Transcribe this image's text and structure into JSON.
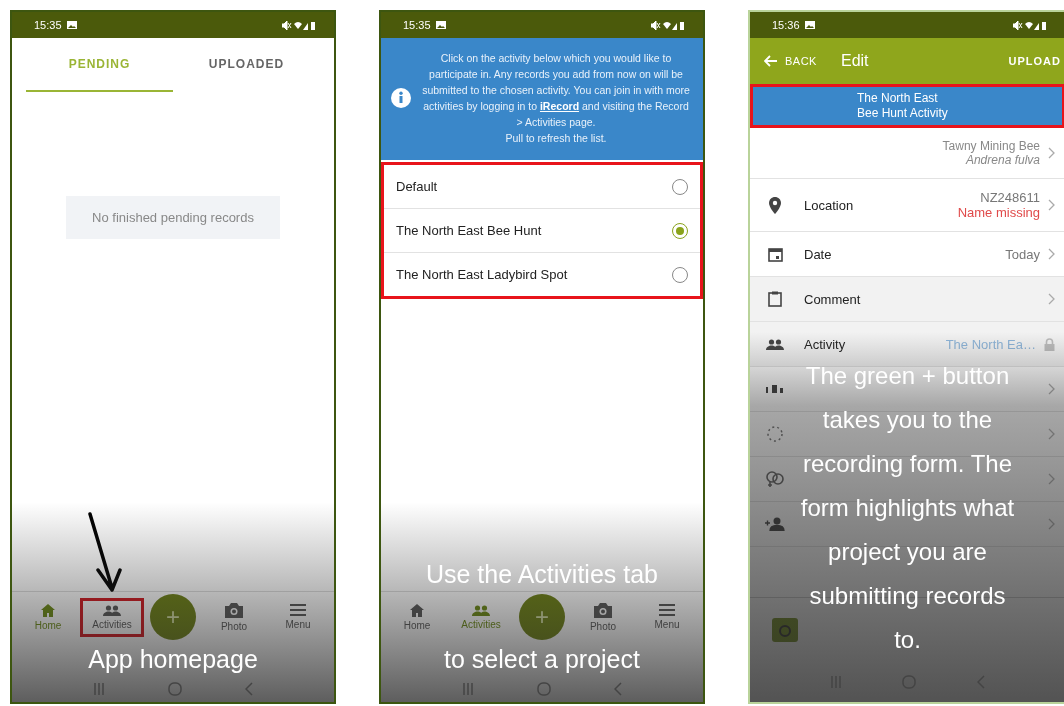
{
  "panels": [
    {
      "kind": "home",
      "status_bar": {
        "time": "15:35"
      },
      "tabs": [
        {
          "label": "PENDING",
          "selected": true
        },
        {
          "label": "UPLOADED",
          "selected": false
        }
      ],
      "empty_message": "No finished pending records",
      "fab": "+",
      "nav": [
        {
          "kind": "home",
          "label": "Home",
          "selected": true,
          "highlighted": false
        },
        {
          "kind": "activities",
          "label": "Activities",
          "selected": false,
          "highlighted": true
        },
        {
          "kind": "photo",
          "label": "Photo",
          "selected": false,
          "highlighted": false
        },
        {
          "kind": "menu",
          "label": "Menu",
          "selected": false,
          "highlighted": false
        }
      ],
      "caption_below_nav": "App homepage"
    },
    {
      "kind": "activities",
      "status_bar": {
        "time": "15:35"
      },
      "info": {
        "text_before": "Click on the activity below which you would like to participate in. Any records you add from now on will be submitted to the chosen activity. You can join in with more activities by logging in to ",
        "link": "iRecord",
        "text_after": " and visiting the Record > Activities page.",
        "hint": "Pull to refresh the list."
      },
      "list_highlighted": true,
      "activities": [
        {
          "name": "Default",
          "selected": false
        },
        {
          "name": "The North East Bee Hunt",
          "selected": true
        },
        {
          "name": "The North East Ladybird Spot",
          "selected": false
        }
      ],
      "fab": "+",
      "nav": [
        {
          "kind": "home",
          "label": "Home",
          "selected": false,
          "highlighted": false
        },
        {
          "kind": "activities",
          "label": "Activities",
          "selected": true,
          "highlighted": false
        },
        {
          "kind": "photo",
          "label": "Photo",
          "selected": false,
          "highlighted": false
        },
        {
          "kind": "menu",
          "label": "Menu",
          "selected": false,
          "highlighted": false
        }
      ],
      "caption_above_nav": "Use the Activities tab",
      "caption_below_nav": "to select a project"
    },
    {
      "kind": "edit",
      "status_bar": {
        "time": "15:36"
      },
      "header": {
        "back": "BACK",
        "title": "Edit",
        "action": "UPLOAD"
      },
      "banner": {
        "lines": [
          "The North East",
          "Bee Hunt Activity"
        ],
        "highlighted": true
      },
      "species": {
        "common": "Tawny Mining Bee",
        "latin": "Andrena fulva"
      },
      "rows": [
        {
          "kind": "location",
          "label": "Location",
          "value": "NZ248611",
          "warning": "Name missing",
          "locked": false
        },
        {
          "kind": "date",
          "label": "Date",
          "value": "Today",
          "locked": false
        },
        {
          "kind": "comment",
          "label": "Comment",
          "locked": false
        },
        {
          "kind": "activity",
          "label": "Activity",
          "value": "The North Ea…",
          "locked": true
        },
        {
          "kind": "abundance",
          "locked": false
        },
        {
          "kind": "stage",
          "locked": false
        },
        {
          "kind": "sex",
          "locked": false
        },
        {
          "kind": "attributes",
          "locked": false
        }
      ],
      "caption_lines": [
        "The green + button",
        "takes you to the",
        "recording form. The",
        "form highlights what",
        "project you are",
        "submitting records",
        "to."
      ]
    }
  ]
}
